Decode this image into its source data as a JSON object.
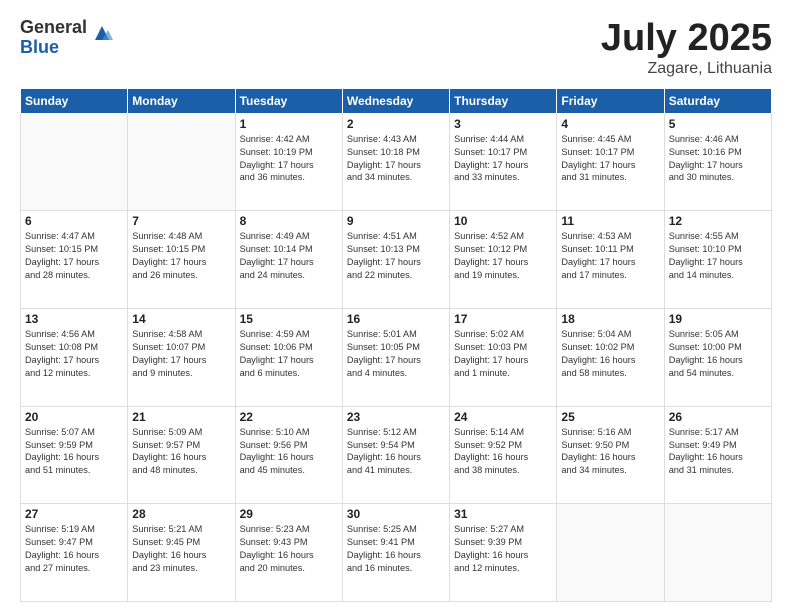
{
  "logo": {
    "general": "General",
    "blue": "Blue"
  },
  "title": {
    "month": "July 2025",
    "location": "Zagare, Lithuania"
  },
  "headers": [
    "Sunday",
    "Monday",
    "Tuesday",
    "Wednesday",
    "Thursday",
    "Friday",
    "Saturday"
  ],
  "weeks": [
    [
      {
        "day": "",
        "detail": ""
      },
      {
        "day": "",
        "detail": ""
      },
      {
        "day": "1",
        "detail": "Sunrise: 4:42 AM\nSunset: 10:19 PM\nDaylight: 17 hours\nand 36 minutes."
      },
      {
        "day": "2",
        "detail": "Sunrise: 4:43 AM\nSunset: 10:18 PM\nDaylight: 17 hours\nand 34 minutes."
      },
      {
        "day": "3",
        "detail": "Sunrise: 4:44 AM\nSunset: 10:17 PM\nDaylight: 17 hours\nand 33 minutes."
      },
      {
        "day": "4",
        "detail": "Sunrise: 4:45 AM\nSunset: 10:17 PM\nDaylight: 17 hours\nand 31 minutes."
      },
      {
        "day": "5",
        "detail": "Sunrise: 4:46 AM\nSunset: 10:16 PM\nDaylight: 17 hours\nand 30 minutes."
      }
    ],
    [
      {
        "day": "6",
        "detail": "Sunrise: 4:47 AM\nSunset: 10:15 PM\nDaylight: 17 hours\nand 28 minutes."
      },
      {
        "day": "7",
        "detail": "Sunrise: 4:48 AM\nSunset: 10:15 PM\nDaylight: 17 hours\nand 26 minutes."
      },
      {
        "day": "8",
        "detail": "Sunrise: 4:49 AM\nSunset: 10:14 PM\nDaylight: 17 hours\nand 24 minutes."
      },
      {
        "day": "9",
        "detail": "Sunrise: 4:51 AM\nSunset: 10:13 PM\nDaylight: 17 hours\nand 22 minutes."
      },
      {
        "day": "10",
        "detail": "Sunrise: 4:52 AM\nSunset: 10:12 PM\nDaylight: 17 hours\nand 19 minutes."
      },
      {
        "day": "11",
        "detail": "Sunrise: 4:53 AM\nSunset: 10:11 PM\nDaylight: 17 hours\nand 17 minutes."
      },
      {
        "day": "12",
        "detail": "Sunrise: 4:55 AM\nSunset: 10:10 PM\nDaylight: 17 hours\nand 14 minutes."
      }
    ],
    [
      {
        "day": "13",
        "detail": "Sunrise: 4:56 AM\nSunset: 10:08 PM\nDaylight: 17 hours\nand 12 minutes."
      },
      {
        "day": "14",
        "detail": "Sunrise: 4:58 AM\nSunset: 10:07 PM\nDaylight: 17 hours\nand 9 minutes."
      },
      {
        "day": "15",
        "detail": "Sunrise: 4:59 AM\nSunset: 10:06 PM\nDaylight: 17 hours\nand 6 minutes."
      },
      {
        "day": "16",
        "detail": "Sunrise: 5:01 AM\nSunset: 10:05 PM\nDaylight: 17 hours\nand 4 minutes."
      },
      {
        "day": "17",
        "detail": "Sunrise: 5:02 AM\nSunset: 10:03 PM\nDaylight: 17 hours\nand 1 minute."
      },
      {
        "day": "18",
        "detail": "Sunrise: 5:04 AM\nSunset: 10:02 PM\nDaylight: 16 hours\nand 58 minutes."
      },
      {
        "day": "19",
        "detail": "Sunrise: 5:05 AM\nSunset: 10:00 PM\nDaylight: 16 hours\nand 54 minutes."
      }
    ],
    [
      {
        "day": "20",
        "detail": "Sunrise: 5:07 AM\nSunset: 9:59 PM\nDaylight: 16 hours\nand 51 minutes."
      },
      {
        "day": "21",
        "detail": "Sunrise: 5:09 AM\nSunset: 9:57 PM\nDaylight: 16 hours\nand 48 minutes."
      },
      {
        "day": "22",
        "detail": "Sunrise: 5:10 AM\nSunset: 9:56 PM\nDaylight: 16 hours\nand 45 minutes."
      },
      {
        "day": "23",
        "detail": "Sunrise: 5:12 AM\nSunset: 9:54 PM\nDaylight: 16 hours\nand 41 minutes."
      },
      {
        "day": "24",
        "detail": "Sunrise: 5:14 AM\nSunset: 9:52 PM\nDaylight: 16 hours\nand 38 minutes."
      },
      {
        "day": "25",
        "detail": "Sunrise: 5:16 AM\nSunset: 9:50 PM\nDaylight: 16 hours\nand 34 minutes."
      },
      {
        "day": "26",
        "detail": "Sunrise: 5:17 AM\nSunset: 9:49 PM\nDaylight: 16 hours\nand 31 minutes."
      }
    ],
    [
      {
        "day": "27",
        "detail": "Sunrise: 5:19 AM\nSunset: 9:47 PM\nDaylight: 16 hours\nand 27 minutes."
      },
      {
        "day": "28",
        "detail": "Sunrise: 5:21 AM\nSunset: 9:45 PM\nDaylight: 16 hours\nand 23 minutes."
      },
      {
        "day": "29",
        "detail": "Sunrise: 5:23 AM\nSunset: 9:43 PM\nDaylight: 16 hours\nand 20 minutes."
      },
      {
        "day": "30",
        "detail": "Sunrise: 5:25 AM\nSunset: 9:41 PM\nDaylight: 16 hours\nand 16 minutes."
      },
      {
        "day": "31",
        "detail": "Sunrise: 5:27 AM\nSunset: 9:39 PM\nDaylight: 16 hours\nand 12 minutes."
      },
      {
        "day": "",
        "detail": ""
      },
      {
        "day": "",
        "detail": ""
      }
    ]
  ]
}
